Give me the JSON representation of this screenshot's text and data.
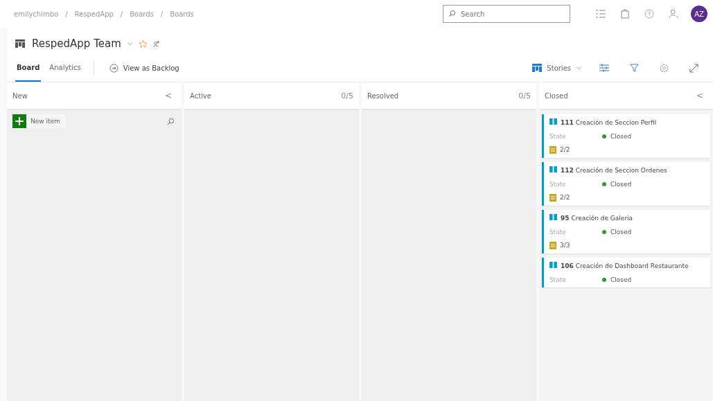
{
  "breadcrumb": {
    "separator": "/",
    "items": [
      "emilychimbo",
      "RespedApp",
      "Boards",
      "Boards"
    ]
  },
  "search": {
    "placeholder": "Search"
  },
  "avatar": {
    "initials": "AZ"
  },
  "team": {
    "name": "RespedApp Team"
  },
  "tabs": [
    {
      "label": "Board",
      "selected": true
    },
    {
      "label": "Analytics",
      "selected": false
    }
  ],
  "view_backlog": "View as Backlog",
  "level_picker": "Stories",
  "columns": [
    {
      "name": "New",
      "collapse": "<",
      "new_item": "New item"
    },
    {
      "name": "Active",
      "limit": "0/5"
    },
    {
      "name": "Resolved",
      "limit": "0/5"
    },
    {
      "name": "Closed",
      "collapse": "<",
      "cards": [
        {
          "id": "111",
          "title": "Creación de Seccion Perfil",
          "field": "State",
          "state": "Closed",
          "color": "#339933",
          "tasks": "2/2"
        },
        {
          "id": "112",
          "title": "Creación de Seccion Ordenes",
          "field": "State",
          "state": "Closed",
          "color": "#339933",
          "tasks": "2/2"
        },
        {
          "id": "95",
          "title": "Creación de Galeria",
          "field": "State",
          "state": "Closed",
          "color": "#339933",
          "tasks": "3/3"
        },
        {
          "id": "106",
          "title": "Creación de Dashboard Restaurante",
          "field": "State",
          "state": "Closed",
          "color": "#339933"
        }
      ]
    }
  ]
}
